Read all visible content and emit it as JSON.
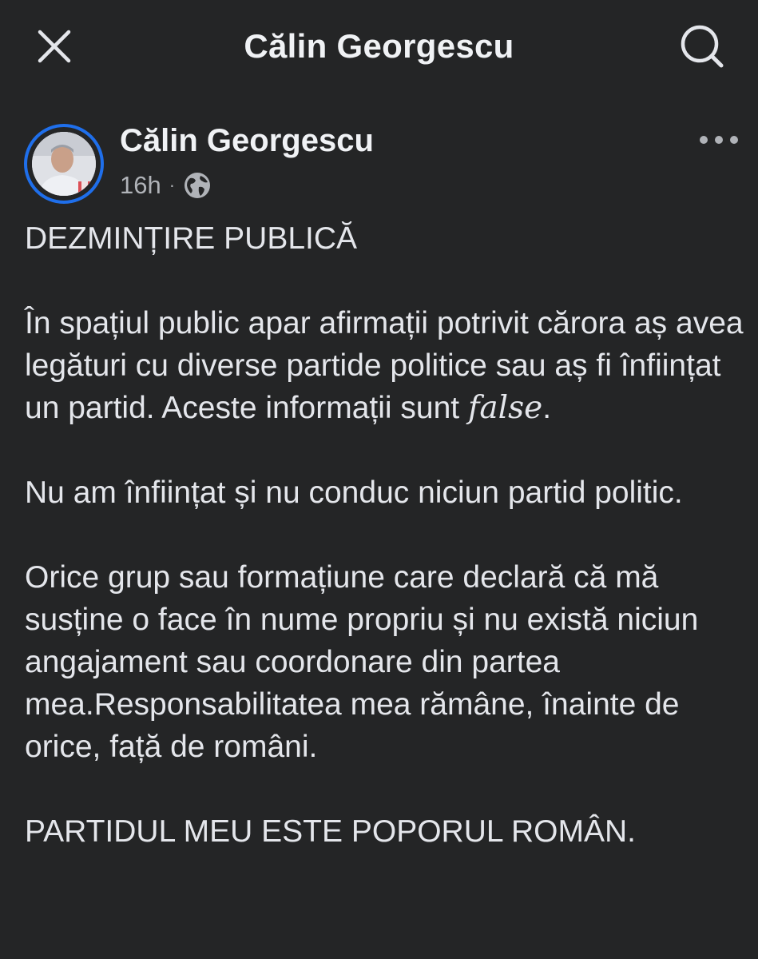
{
  "header": {
    "title": "Călin Georgescu",
    "close_icon": "close-icon",
    "search_icon": "search-icon"
  },
  "post": {
    "author": "Călin Georgescu",
    "time": "16h",
    "separator": "·",
    "audience_icon": "globe-icon",
    "more_icon": "more-icon",
    "paragraphs": {
      "p0": "DEZMINȚIRE PUBLICĂ",
      "p1_before": "În spațiul public apar afirmații potrivit cărora aș avea legături cu diverse partide politice sau aș fi înființat un partid. Aceste informații sunt ",
      "p1_em": "false",
      "p1_after": ".",
      "p2": "Nu am înființat și nu conduc niciun partid politic.",
      "p3": "Orice grup sau formațiune care declară că mă susține o face în nume propriu și nu există niciun angajament sau coordonare din partea mea.Responsabilitatea mea rămâne, înainte de orice, față de români.",
      "p4": "PARTIDUL MEU ESTE POPORUL ROMÂN."
    }
  },
  "colors": {
    "background": "#242526",
    "text": "#e4e6eb",
    "secondary_text": "#b0b3b8",
    "avatar_ring": "#1f6feb"
  }
}
